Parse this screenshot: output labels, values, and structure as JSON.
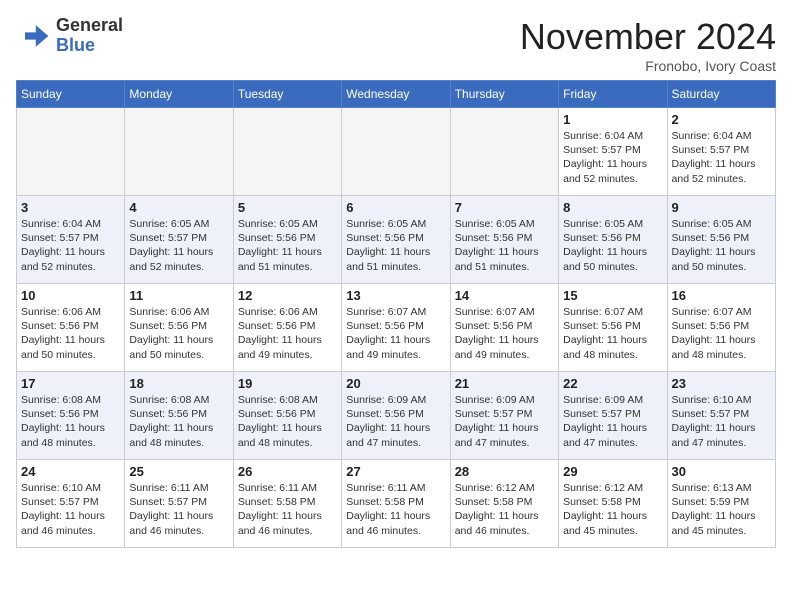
{
  "header": {
    "logo_line1": "General",
    "logo_line2": "Blue",
    "month": "November 2024",
    "location": "Fronobo, Ivory Coast"
  },
  "days_of_week": [
    "Sunday",
    "Monday",
    "Tuesday",
    "Wednesday",
    "Thursday",
    "Friday",
    "Saturday"
  ],
  "weeks": [
    [
      {
        "day": null,
        "info": null
      },
      {
        "day": null,
        "info": null
      },
      {
        "day": null,
        "info": null
      },
      {
        "day": null,
        "info": null
      },
      {
        "day": null,
        "info": null
      },
      {
        "day": "1",
        "info": "Sunrise: 6:04 AM\nSunset: 5:57 PM\nDaylight: 11 hours\nand 52 minutes."
      },
      {
        "day": "2",
        "info": "Sunrise: 6:04 AM\nSunset: 5:57 PM\nDaylight: 11 hours\nand 52 minutes."
      }
    ],
    [
      {
        "day": "3",
        "info": "Sunrise: 6:04 AM\nSunset: 5:57 PM\nDaylight: 11 hours\nand 52 minutes."
      },
      {
        "day": "4",
        "info": "Sunrise: 6:05 AM\nSunset: 5:57 PM\nDaylight: 11 hours\nand 52 minutes."
      },
      {
        "day": "5",
        "info": "Sunrise: 6:05 AM\nSunset: 5:56 PM\nDaylight: 11 hours\nand 51 minutes."
      },
      {
        "day": "6",
        "info": "Sunrise: 6:05 AM\nSunset: 5:56 PM\nDaylight: 11 hours\nand 51 minutes."
      },
      {
        "day": "7",
        "info": "Sunrise: 6:05 AM\nSunset: 5:56 PM\nDaylight: 11 hours\nand 51 minutes."
      },
      {
        "day": "8",
        "info": "Sunrise: 6:05 AM\nSunset: 5:56 PM\nDaylight: 11 hours\nand 50 minutes."
      },
      {
        "day": "9",
        "info": "Sunrise: 6:05 AM\nSunset: 5:56 PM\nDaylight: 11 hours\nand 50 minutes."
      }
    ],
    [
      {
        "day": "10",
        "info": "Sunrise: 6:06 AM\nSunset: 5:56 PM\nDaylight: 11 hours\nand 50 minutes."
      },
      {
        "day": "11",
        "info": "Sunrise: 6:06 AM\nSunset: 5:56 PM\nDaylight: 11 hours\nand 50 minutes."
      },
      {
        "day": "12",
        "info": "Sunrise: 6:06 AM\nSunset: 5:56 PM\nDaylight: 11 hours\nand 49 minutes."
      },
      {
        "day": "13",
        "info": "Sunrise: 6:07 AM\nSunset: 5:56 PM\nDaylight: 11 hours\nand 49 minutes."
      },
      {
        "day": "14",
        "info": "Sunrise: 6:07 AM\nSunset: 5:56 PM\nDaylight: 11 hours\nand 49 minutes."
      },
      {
        "day": "15",
        "info": "Sunrise: 6:07 AM\nSunset: 5:56 PM\nDaylight: 11 hours\nand 48 minutes."
      },
      {
        "day": "16",
        "info": "Sunrise: 6:07 AM\nSunset: 5:56 PM\nDaylight: 11 hours\nand 48 minutes."
      }
    ],
    [
      {
        "day": "17",
        "info": "Sunrise: 6:08 AM\nSunset: 5:56 PM\nDaylight: 11 hours\nand 48 minutes."
      },
      {
        "day": "18",
        "info": "Sunrise: 6:08 AM\nSunset: 5:56 PM\nDaylight: 11 hours\nand 48 minutes."
      },
      {
        "day": "19",
        "info": "Sunrise: 6:08 AM\nSunset: 5:56 PM\nDaylight: 11 hours\nand 48 minutes."
      },
      {
        "day": "20",
        "info": "Sunrise: 6:09 AM\nSunset: 5:56 PM\nDaylight: 11 hours\nand 47 minutes."
      },
      {
        "day": "21",
        "info": "Sunrise: 6:09 AM\nSunset: 5:57 PM\nDaylight: 11 hours\nand 47 minutes."
      },
      {
        "day": "22",
        "info": "Sunrise: 6:09 AM\nSunset: 5:57 PM\nDaylight: 11 hours\nand 47 minutes."
      },
      {
        "day": "23",
        "info": "Sunrise: 6:10 AM\nSunset: 5:57 PM\nDaylight: 11 hours\nand 47 minutes."
      }
    ],
    [
      {
        "day": "24",
        "info": "Sunrise: 6:10 AM\nSunset: 5:57 PM\nDaylight: 11 hours\nand 46 minutes."
      },
      {
        "day": "25",
        "info": "Sunrise: 6:11 AM\nSunset: 5:57 PM\nDaylight: 11 hours\nand 46 minutes."
      },
      {
        "day": "26",
        "info": "Sunrise: 6:11 AM\nSunset: 5:58 PM\nDaylight: 11 hours\nand 46 minutes."
      },
      {
        "day": "27",
        "info": "Sunrise: 6:11 AM\nSunset: 5:58 PM\nDaylight: 11 hours\nand 46 minutes."
      },
      {
        "day": "28",
        "info": "Sunrise: 6:12 AM\nSunset: 5:58 PM\nDaylight: 11 hours\nand 46 minutes."
      },
      {
        "day": "29",
        "info": "Sunrise: 6:12 AM\nSunset: 5:58 PM\nDaylight: 11 hours\nand 45 minutes."
      },
      {
        "day": "30",
        "info": "Sunrise: 6:13 AM\nSunset: 5:59 PM\nDaylight: 11 hours\nand 45 minutes."
      }
    ]
  ]
}
